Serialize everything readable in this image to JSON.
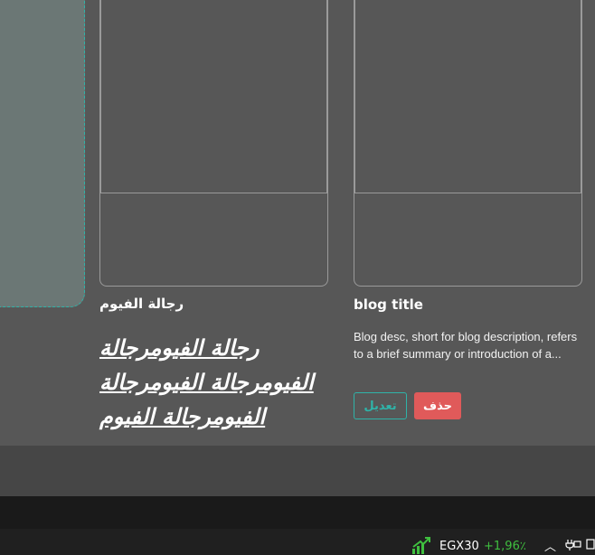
{
  "cards": [
    {
      "title": "رجالة الفيوم",
      "description": "رجالة الفيومرجالة الفيومرجالة الفيومرجالة الفيومرجالة الفيوم"
    },
    {
      "title": "blog title",
      "description": "Blog desc, short for blog description, refers to a brief summary or introduction of a...",
      "edit_label": "تعديل",
      "delete_label": "حذف"
    }
  ],
  "taskbar": {
    "ticker_name": "EGX30",
    "ticker_change": "+1,96٪"
  },
  "colors": {
    "accent": "#2fb3a8",
    "danger": "#e05a5a",
    "positive": "#3fbf3f",
    "background": "#575757"
  }
}
